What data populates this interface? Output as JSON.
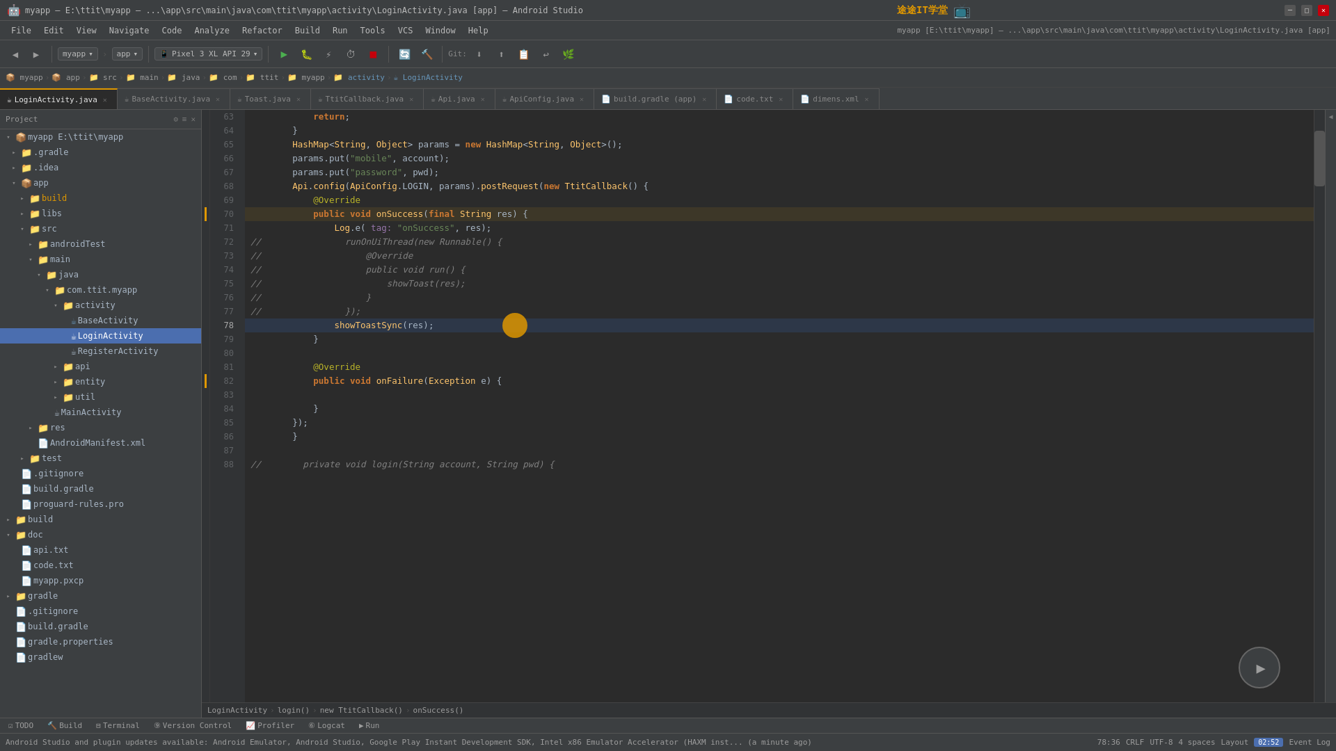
{
  "app": {
    "title": "myapp – E:\\ttit\\myapp – ...\\app\\src\\main\\java\\com\\ttit\\myapp\\activity\\LoginActivity.java [app] – Android Studio",
    "icon": "🤖"
  },
  "menu": {
    "items": [
      "File",
      "Edit",
      "View",
      "Navigate",
      "Code",
      "Analyze",
      "Refactor",
      "Build",
      "Run",
      "Tools",
      "VCS",
      "Window",
      "Help"
    ]
  },
  "toolbar": {
    "project_selector": "myapp",
    "module_selector": "app",
    "device_selector": "Pixel 3 XL API 29",
    "git_label": "Git:"
  },
  "breadcrumb": {
    "items": [
      "myapp",
      "app",
      "src",
      "main",
      "java",
      "com",
      "ttit",
      "myapp",
      "activity",
      "LoginActivity"
    ]
  },
  "tabs": [
    {
      "label": "LoginActivity.java",
      "active": true,
      "icon": "☕"
    },
    {
      "label": "BaseActivity.java",
      "active": false,
      "icon": "☕"
    },
    {
      "label": "Toast.java",
      "active": false,
      "icon": "☕"
    },
    {
      "label": "TtitCallback.java",
      "active": false,
      "icon": "☕"
    },
    {
      "label": "Api.java",
      "active": false,
      "icon": "☕"
    },
    {
      "label": "ApiConfig.java",
      "active": false,
      "icon": "☕"
    },
    {
      "label": "build.gradle (app)",
      "active": false,
      "icon": "📄"
    },
    {
      "label": "code.txt",
      "active": false,
      "icon": "📄"
    },
    {
      "label": "dimens.xml",
      "active": false,
      "icon": "📄"
    }
  ],
  "sidebar": {
    "header": "Project",
    "tree": [
      {
        "level": 0,
        "type": "folder",
        "label": "myapp E:\\ttit\\myapp",
        "expanded": true,
        "icon": "📁"
      },
      {
        "level": 1,
        "type": "folder",
        "label": ".gradle",
        "expanded": false,
        "icon": "📁"
      },
      {
        "level": 1,
        "type": "folder",
        "label": ".idea",
        "expanded": false,
        "icon": "📁"
      },
      {
        "level": 1,
        "type": "folder",
        "label": "app",
        "expanded": true,
        "icon": "📦"
      },
      {
        "level": 2,
        "type": "folder",
        "label": "build",
        "expanded": false,
        "icon": "📁",
        "color": "orange"
      },
      {
        "level": 2,
        "type": "folder",
        "label": "libs",
        "expanded": false,
        "icon": "📁"
      },
      {
        "level": 2,
        "type": "folder",
        "label": "src",
        "expanded": true,
        "icon": "📁"
      },
      {
        "level": 3,
        "type": "folder",
        "label": "androidTest",
        "expanded": false,
        "icon": "📁"
      },
      {
        "level": 3,
        "type": "folder",
        "label": "main",
        "expanded": true,
        "icon": "📁"
      },
      {
        "level": 4,
        "type": "folder",
        "label": "java",
        "expanded": true,
        "icon": "📁"
      },
      {
        "level": 5,
        "type": "folder",
        "label": "com.ttit.myapp",
        "expanded": true,
        "icon": "📁"
      },
      {
        "level": 6,
        "type": "folder",
        "label": "activity",
        "expanded": true,
        "icon": "📁"
      },
      {
        "level": 7,
        "type": "file",
        "label": "BaseActivity",
        "icon": "☕",
        "color": "blue"
      },
      {
        "level": 7,
        "type": "file",
        "label": "LoginActivity",
        "icon": "☕",
        "selected": true
      },
      {
        "level": 7,
        "type": "file",
        "label": "RegisterActivity",
        "icon": "☕"
      },
      {
        "level": 5,
        "type": "folder",
        "label": "api",
        "expanded": false,
        "icon": "📁"
      },
      {
        "level": 5,
        "type": "folder",
        "label": "entity",
        "expanded": false,
        "icon": "📁"
      },
      {
        "level": 5,
        "type": "folder",
        "label": "util",
        "expanded": false,
        "icon": "📁"
      },
      {
        "level": 4,
        "type": "file",
        "label": "MainActivity",
        "icon": "☕"
      },
      {
        "level": 3,
        "type": "folder",
        "label": "res",
        "expanded": false,
        "icon": "📁"
      },
      {
        "level": 3,
        "type": "file",
        "label": "AndroidManifest.xml",
        "icon": "📄"
      },
      {
        "level": 2,
        "type": "folder",
        "label": "test",
        "expanded": false,
        "icon": "📁"
      },
      {
        "level": 1,
        "type": "file",
        "label": ".gitignore",
        "icon": "📄"
      },
      {
        "level": 1,
        "type": "file",
        "label": "build.gradle",
        "icon": "📄"
      },
      {
        "level": 1,
        "type": "file",
        "label": "proguard-rules.pro",
        "icon": "📄"
      },
      {
        "level": 0,
        "type": "folder",
        "label": "build",
        "expanded": false,
        "icon": "📁"
      },
      {
        "level": 0,
        "type": "folder",
        "label": "doc",
        "expanded": true,
        "icon": "📁"
      },
      {
        "level": 1,
        "type": "file",
        "label": "api.txt",
        "icon": "📄"
      },
      {
        "level": 1,
        "type": "file",
        "label": "code.txt",
        "icon": "📄"
      },
      {
        "level": 1,
        "type": "file",
        "label": "myapp.pxcp",
        "icon": "📄"
      },
      {
        "level": 0,
        "type": "folder",
        "label": "gradle",
        "expanded": false,
        "icon": "📁"
      },
      {
        "level": 0,
        "type": "file",
        "label": ".gitignore",
        "icon": "📄"
      },
      {
        "level": 0,
        "type": "file",
        "label": "build.gradle",
        "icon": "📄"
      },
      {
        "level": 0,
        "type": "file",
        "label": "gradle.properties",
        "icon": "📄"
      },
      {
        "level": 0,
        "type": "file",
        "label": "gradlew",
        "icon": "📄"
      }
    ]
  },
  "code": {
    "lines": [
      {
        "num": 63,
        "content": "            return;",
        "type": "normal"
      },
      {
        "num": 64,
        "content": "        }",
        "type": "normal"
      },
      {
        "num": 65,
        "content": "        HashMap<String, Object> params = new HashMap<String, Object>();",
        "type": "normal"
      },
      {
        "num": 66,
        "content": "        params.put(\"mobile\", account);",
        "type": "normal"
      },
      {
        "num": 67,
        "content": "        params.put(\"password\", pwd);",
        "type": "normal"
      },
      {
        "num": 68,
        "content": "        Api.config(ApiConfig.LOGIN, params).postRequest(new TtitCallback() {",
        "type": "normal"
      },
      {
        "num": 69,
        "content": "            @Override",
        "type": "normal"
      },
      {
        "num": 70,
        "content": "            public void onSuccess(final String res) {",
        "type": "marker"
      },
      {
        "num": 71,
        "content": "                Log.e( tag: \"onSuccess\", res);",
        "type": "normal"
      },
      {
        "num": 72,
        "content": "//                runOnUiThread(new Runnable() {",
        "type": "comment"
      },
      {
        "num": 73,
        "content": "//                    @Override",
        "type": "comment"
      },
      {
        "num": 74,
        "content": "//                    public void run() {",
        "type": "comment"
      },
      {
        "num": 75,
        "content": "//                        showToast(res);",
        "type": "comment"
      },
      {
        "num": 76,
        "content": "//                    }",
        "type": "comment"
      },
      {
        "num": 77,
        "content": "//                });",
        "type": "comment"
      },
      {
        "num": 78,
        "content": "                showToastSync(res);",
        "type": "highlighted"
      },
      {
        "num": 79,
        "content": "            }",
        "type": "normal"
      },
      {
        "num": 80,
        "content": "",
        "type": "normal"
      },
      {
        "num": 81,
        "content": "            @Override",
        "type": "normal"
      },
      {
        "num": 82,
        "content": "            public void onFailure(Exception e) {",
        "type": "marker"
      },
      {
        "num": 83,
        "content": "",
        "type": "normal"
      },
      {
        "num": 84,
        "content": "            }",
        "type": "normal"
      },
      {
        "num": 85,
        "content": "        });",
        "type": "normal"
      },
      {
        "num": 86,
        "content": "        }",
        "type": "normal"
      },
      {
        "num": 87,
        "content": "",
        "type": "normal"
      },
      {
        "num": 88,
        "content": "//        private void login(String account, String pwd) {",
        "type": "comment"
      }
    ]
  },
  "nav_breadcrumb": {
    "items": [
      "LoginActivity",
      "login()",
      "new TtitCallback()",
      "onSuccess()"
    ]
  },
  "status_bar": {
    "message": "Android Studio and plugin updates available: Android Emulator, Android Studio, Google Play Instant Development SDK, Intel x86 Emulator Accelerator (HAXM inst... (a minute ago)",
    "position": "78:36",
    "line_sep": "CRLF",
    "encoding": "UTF-8",
    "indent": "4 spaces",
    "layout": "Layout",
    "event_log": "Event Log",
    "time": "02:52"
  },
  "bottom_tabs": [
    {
      "label": "TODO",
      "icon": "☑"
    },
    {
      "label": "Build",
      "icon": "🔨"
    },
    {
      "label": "Terminal",
      "icon": "⊟"
    },
    {
      "label": "Version Control",
      "icon": "9:"
    },
    {
      "label": "Profiler",
      "icon": "📈"
    },
    {
      "label": "Logcat",
      "icon": "6:"
    },
    {
      "label": "Run",
      "icon": "▶"
    }
  ]
}
